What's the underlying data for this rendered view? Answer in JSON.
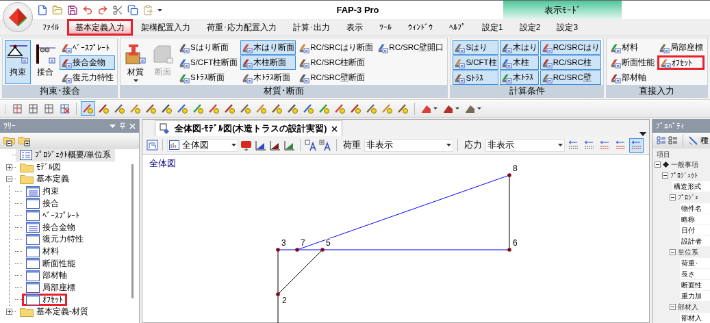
{
  "window": {
    "title": "FAP-3 Pro",
    "context_tab": "表示ﾓｰﾄﾞ"
  },
  "menu_tabs": [
    {
      "label": "ﾌｧｲﾙ",
      "selected": false,
      "highlighted": false
    },
    {
      "label": "基本定義入力",
      "selected": true,
      "highlighted": true
    },
    {
      "label": "架構配置入力",
      "selected": false,
      "highlighted": false
    },
    {
      "label": "荷重･応力配置入力",
      "selected": false,
      "highlighted": false
    },
    {
      "label": "計算･出力",
      "selected": false,
      "highlighted": false
    },
    {
      "label": "表示",
      "selected": false,
      "highlighted": false
    },
    {
      "label": "ﾂｰﾙ",
      "selected": false,
      "highlighted": false
    },
    {
      "label": "ｳｨﾝﾄﾞｳ",
      "selected": false,
      "highlighted": false
    },
    {
      "label": "ﾍﾙﾌﾟ",
      "selected": false,
      "highlighted": false
    },
    {
      "label": "設定1",
      "selected": false,
      "highlighted": false
    },
    {
      "label": "設定2",
      "selected": false,
      "highlighted": false
    },
    {
      "label": "設定3",
      "selected": false,
      "highlighted": false
    }
  ],
  "ribbon": {
    "groups": [
      {
        "label": "拘束･接合",
        "large": [
          {
            "label": "拘束",
            "kind": "support",
            "selected": true,
            "disabled": false,
            "dropdown": false
          },
          {
            "label": "接合",
            "kind": "joint",
            "selected": false,
            "disabled": false,
            "dropdown": false
          }
        ],
        "columns": [
          [
            {
              "label": "ﾍﾞｰｽﾌﾟﾚｰﾄ",
              "selected": false,
              "highlighted": false
            },
            {
              "label": "接合金物",
              "selected": true,
              "highlighted": false
            },
            {
              "label": "復元力特性",
              "selected": false,
              "highlighted": false
            }
          ]
        ]
      },
      {
        "label": "材質･断面",
        "large": [
          {
            "label": "材質",
            "kind": "material",
            "selected": false,
            "disabled": false,
            "dropdown": true
          },
          {
            "label": "断面",
            "kind": "section",
            "selected": false,
            "disabled": true,
            "dropdown": false
          }
        ],
        "columns": [
          [
            {
              "label": "Sはり断面",
              "selected": false,
              "highlighted": false
            },
            {
              "label": "S/CFT柱断面",
              "selected": false,
              "highlighted": false
            },
            {
              "label": "Sﾄﾗｽ断面",
              "selected": false,
              "highlighted": false
            }
          ],
          [
            {
              "label": "木はり断面",
              "selected": true,
              "highlighted": false
            },
            {
              "label": "木柱断面",
              "selected": true,
              "highlighted": false
            },
            {
              "label": "木ﾄﾗｽ断面",
              "selected": false,
              "highlighted": false
            }
          ],
          [
            {
              "label": "RC/SRCはり断面",
              "selected": false,
              "highlighted": false
            },
            {
              "label": "RC/SRC柱断面",
              "selected": false,
              "highlighted": false
            },
            {
              "label": "RC/SRC壁断面",
              "selected": false,
              "highlighted": false
            }
          ],
          [
            {
              "label": "RC/SRC壁開口",
              "selected": false,
              "highlighted": false
            }
          ]
        ]
      },
      {
        "label": "計算条件",
        "columns": [
          [
            {
              "label": "Sはり",
              "selected": true,
              "highlighted": false
            },
            {
              "label": "S/CFT柱",
              "selected": true,
              "highlighted": false
            },
            {
              "label": "Sﾄﾗｽ",
              "selected": true,
              "highlighted": false
            }
          ],
          [
            {
              "label": "木はり",
              "selected": true,
              "highlighted": false
            },
            {
              "label": "木柱",
              "selected": true,
              "highlighted": false
            },
            {
              "label": "木ﾄﾗｽ",
              "selected": true,
              "highlighted": false
            }
          ],
          [
            {
              "label": "RC/SRCはり",
              "selected": true,
              "highlighted": false
            },
            {
              "label": "RC/SRC柱",
              "selected": true,
              "highlighted": false
            },
            {
              "label": "RC/SRC壁",
              "selected": true,
              "highlighted": false
            }
          ]
        ]
      },
      {
        "label": "直接入力",
        "columns": [
          [
            {
              "label": "材料",
              "selected": false,
              "highlighted": false
            },
            {
              "label": "断面性能",
              "selected": false,
              "highlighted": false
            },
            {
              "label": "部材軸",
              "selected": false,
              "highlighted": false
            }
          ],
          [
            {
              "label": "局部座標",
              "selected": false,
              "highlighted": false
            },
            {
              "label": "ｵﾌｾｯﾄ",
              "selected": false,
              "highlighted": true
            }
          ]
        ]
      }
    ]
  },
  "toolbar": {
    "groups": [
      {
        "kind": "frame",
        "buttons": [
          {
            "selected": false
          },
          {
            "selected": false
          },
          {
            "selected": false
          },
          {
            "selected": false
          }
        ]
      },
      {
        "kind": "marker",
        "buttons": [
          {
            "selected": true
          },
          {
            "selected": false
          },
          {
            "selected": false
          },
          {
            "selected": false
          },
          {
            "selected": false
          },
          {
            "selected": false
          },
          {
            "selected": false
          },
          {
            "selected": false
          },
          {
            "selected": false
          },
          {
            "selected": false
          },
          {
            "selected": false
          },
          {
            "selected": false
          },
          {
            "selected": false
          },
          {
            "selected": false
          },
          {
            "selected": false
          },
          {
            "selected": false
          },
          {
            "selected": false
          },
          {
            "selected": false
          },
          {
            "selected": false
          },
          {
            "selected": false
          },
          {
            "selected": false
          }
        ]
      },
      {
        "kind": "dropdown",
        "buttons": [
          {
            "selected": false
          },
          {
            "selected": false
          },
          {
            "selected": false
          }
        ]
      }
    ]
  },
  "tree_panel": {
    "title": "ﾂﾘｰ",
    "items": [
      {
        "label": "ﾌﾟﾛｼﾞｪｸﾄ概要/単位系",
        "kind": "doc",
        "selected": true,
        "highlighted": false
      },
      {
        "label": "ﾓﾃﾞﾙ図",
        "kind": "folder",
        "expanded": false,
        "selected": false,
        "highlighted": false
      },
      {
        "label": "基本定義",
        "kind": "folder",
        "expanded": true,
        "selected": false,
        "highlighted": false,
        "children": [
          {
            "label": "拘束",
            "kind": "table-filled",
            "selected": false,
            "highlighted": false
          },
          {
            "label": "接合",
            "kind": "table",
            "selected": false,
            "highlighted": false
          },
          {
            "label": "ﾍﾞｰｽﾌﾟﾚｰﾄ",
            "kind": "table",
            "selected": false,
            "highlighted": false
          },
          {
            "label": "接合金物",
            "kind": "table-filled",
            "selected": false,
            "highlighted": false
          },
          {
            "label": "復元力特性",
            "kind": "table",
            "selected": false,
            "highlighted": false
          },
          {
            "label": "材料",
            "kind": "table",
            "selected": false,
            "highlighted": false
          },
          {
            "label": "断面性能",
            "kind": "table",
            "selected": false,
            "highlighted": false
          },
          {
            "label": "部材軸",
            "kind": "table",
            "selected": false,
            "highlighted": false
          },
          {
            "label": "局部座標",
            "kind": "table",
            "selected": false,
            "highlighted": false
          },
          {
            "label": "ｵﾌｾｯﾄ",
            "kind": "table",
            "selected": false,
            "highlighted": true
          }
        ]
      },
      {
        "label": "基本定義-材質",
        "kind": "folder",
        "expanded": false,
        "selected": false,
        "highlighted": false
      }
    ]
  },
  "document": {
    "tab": {
      "label": "全体図-ﾓﾃﾞﾙ図(木造トラスの設計実習)",
      "selected": true
    },
    "toolbar": {
      "view_select": "全体図",
      "load": {
        "label": "荷重",
        "value": "非表示"
      },
      "stress": {
        "label": "応力",
        "value": "非表示"
      },
      "number_buttons": [
        {
          "selected": false
        },
        {
          "selected": false
        },
        {
          "selected": false
        },
        {
          "selected": false
        },
        {
          "selected": true
        }
      ]
    },
    "view_label": "全体図",
    "model": {
      "nodes": [
        {
          "label": "8"
        },
        {
          "label": "3"
        },
        {
          "label": "7"
        },
        {
          "label": "5"
        },
        {
          "label": "6"
        },
        {
          "label": "2"
        }
      ],
      "members": [
        {
          "kind": "beam"
        },
        {
          "kind": "beam"
        },
        {
          "kind": "beam"
        },
        {
          "kind": "beam"
        },
        {
          "kind": "truss"
        },
        {
          "kind": "truss"
        },
        {
          "kind": "truss"
        },
        {
          "kind": "truss"
        }
      ]
    }
  },
  "property_panel": {
    "title": "ﾌﾟﾛﾊﾟﾃｨ",
    "toolbar_label": "種",
    "header": "項目",
    "items": [
      {
        "label": "一般事項",
        "kind": "category",
        "expanded": true,
        "children": [
          {
            "label": "ﾌﾟﾛｼﾞｪｸﾄ",
            "kind": "group",
            "expanded": true,
            "children": [
              {
                "label": "構造形式",
                "kind": "row"
              },
              {
                "label": "ﾌﾟﾛｼﾞｪ",
                "kind": "group",
                "expanded": true,
                "children": [
                  {
                    "label": "物件名",
                    "kind": "row"
                  },
                  {
                    "label": "略称",
                    "kind": "row"
                  },
                  {
                    "label": "日付",
                    "kind": "row"
                  },
                  {
                    "label": "設計者",
                    "kind": "row"
                  }
                ]
              },
              {
                "label": "単位系",
                "kind": "group",
                "expanded": true,
                "children": [
                  {
                    "label": "荷重･",
                    "kind": "row"
                  },
                  {
                    "label": "長さ",
                    "kind": "row"
                  },
                  {
                    "label": "断面性",
                    "kind": "row"
                  },
                  {
                    "label": "重力加",
                    "kind": "row"
                  }
                ]
              },
              {
                "label": "部材入",
                "kind": "group",
                "expanded": true,
                "children": [
                  {
                    "label": "部材入",
                    "kind": "row"
                  }
                ]
              }
            ]
          }
        ]
      }
    ]
  }
}
